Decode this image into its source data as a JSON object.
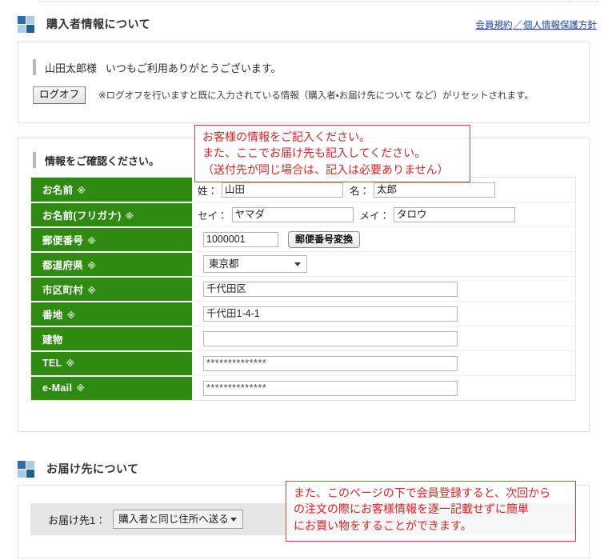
{
  "top_partial_table": {
    "present": true
  },
  "buyer_section": {
    "icon": "checker-square-icon",
    "title": "購入者情報について",
    "links": [
      {
        "label": "会員規約"
      },
      {
        "label": "個人情報保護方針"
      }
    ],
    "link_separator": "／",
    "greeting": {
      "customer_name": "山田太郎様",
      "message": "いつもご利用ありがとうございます。"
    },
    "logoff_button": "ログオフ",
    "logoff_note": "※ログオフを行いますと既に入力されている情報（購入者・お届け先について など）がリセットされます。"
  },
  "form_section": {
    "confirm_heading": "情報をご確認ください。",
    "required_mark": "※",
    "rows": [
      {
        "label": "お名前",
        "required": true,
        "type": "name_pair",
        "sub1_label": "姓：",
        "sub1_value": "山田",
        "sub2_label": "名：",
        "sub2_value": "太郎"
      },
      {
        "label": "お名前(フリガナ)",
        "required": true,
        "type": "name_pair",
        "sub1_label": "セイ：",
        "sub1_value": "ヤマダ",
        "sub2_label": "メイ：",
        "sub2_value": "タロウ"
      },
      {
        "label": "郵便番号",
        "required": true,
        "type": "zip",
        "value": "1000001",
        "button_label": "郵便番号変換"
      },
      {
        "label": "都道府県",
        "required": true,
        "type": "select",
        "value": "東京都"
      },
      {
        "label": "市区町村",
        "required": true,
        "type": "text",
        "value": "千代田区"
      },
      {
        "label": "番地",
        "required": true,
        "type": "text",
        "value": "千代田1-4-1"
      },
      {
        "label": "建物",
        "required": false,
        "type": "text",
        "value": ""
      },
      {
        "label": "TEL",
        "required": true,
        "type": "text",
        "value": "**************"
      },
      {
        "label": "e-Mail",
        "required": true,
        "type": "text",
        "value": "**************"
      }
    ]
  },
  "shipping_section": {
    "icon": "checker-square-icon",
    "title": "お届け先について",
    "destination_label": "お届け先1：",
    "destination_value": "購入者と同じ住所へ送る"
  },
  "annotations": [
    {
      "name": "callout-customer-info",
      "lines": [
        "お客様の情報をご記入ください。",
        "また、ここでお届け先も記入してください。",
        "（送付先が同じ場合は、記入は必要ありません）"
      ]
    },
    {
      "name": "callout-member-registration",
      "lines": [
        "また、このページの下で会員登録すると、次回から",
        "の注文の際にお客様情報を逐一記載せずに簡単",
        "にお買い物をすることができます。"
      ]
    }
  ],
  "colors": {
    "header_green": "#2f8a12",
    "link_blue": "#1a3fb0",
    "callout_red": "#dd2222",
    "icon_dark_blue": "#1f5fa0",
    "icon_light_blue": "#aacbe6",
    "shipping_bar_gray": "#e6e6e6"
  }
}
